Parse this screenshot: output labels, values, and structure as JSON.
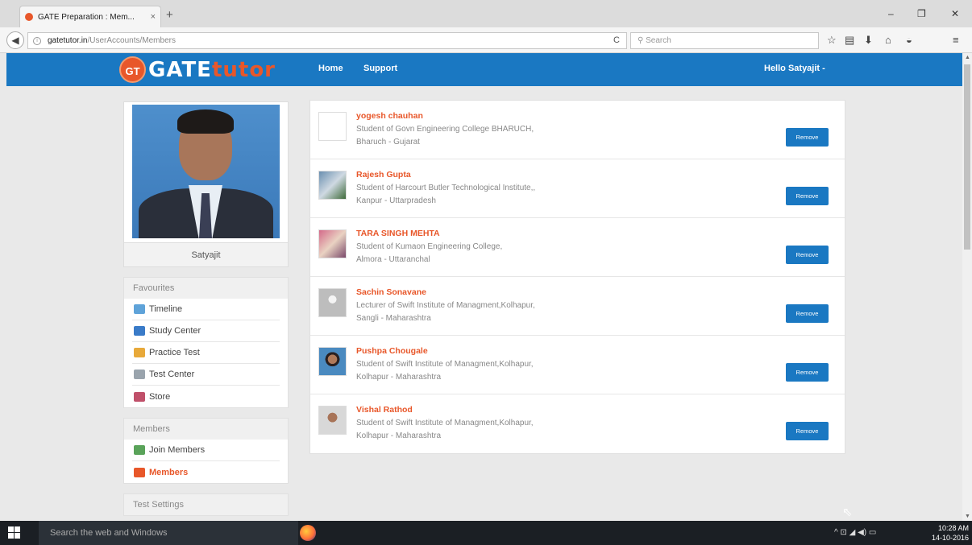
{
  "browser": {
    "tab_title": "GATE Preparation : Mem...",
    "tab_close": "×",
    "new_tab": "+",
    "url_domain": "gatetutor.in",
    "url_path": "/UserAccounts/Members",
    "reload": "C",
    "search_placeholder": "Search",
    "window_controls": {
      "minimize": "–",
      "restore": "❐",
      "close": "✕"
    }
  },
  "header": {
    "logo_badge": "GT",
    "logo_text_1": "GATE",
    "logo_text_2": "tutor",
    "nav": [
      "Home",
      "Support"
    ],
    "user_greeting": "Hello Satyajit -"
  },
  "profile": {
    "name": "Satyajit"
  },
  "sidebar": {
    "favourites_title": "Favourites",
    "favourites": [
      {
        "label": "Timeline",
        "icon": "timeline-icon",
        "color": "#5fa3d9"
      },
      {
        "label": "Study Center",
        "icon": "study-center-icon",
        "color": "#3a7bc8"
      },
      {
        "label": "Practice Test",
        "icon": "practice-test-icon",
        "color": "#e8a93a"
      },
      {
        "label": "Test Center",
        "icon": "test-center-icon",
        "color": "#9aa4ad"
      },
      {
        "label": "Store",
        "icon": "store-icon",
        "color": "#c0506a"
      }
    ],
    "members_title": "Members",
    "members_links": [
      {
        "label": "Join Members",
        "icon": "join-members-icon",
        "color": "#5aa35a",
        "active": false
      },
      {
        "label": "Members",
        "icon": "members-icon",
        "color": "#e8572a",
        "active": true
      }
    ],
    "test_settings_title": "Test Settings"
  },
  "members": [
    {
      "name": "yogesh chauhan",
      "line1": "Student of Govn Engineering College BHARUCH,",
      "line2": "Bharuch - Gujarat",
      "avatar": "blank",
      "button": "Remove"
    },
    {
      "name": "Rajesh Gupta",
      "line1": "Student of Harcourt Butler Technological Institute,,",
      "line2": "Kanpur - Uttarpradesh",
      "avatar": "photo",
      "button": "Remove"
    },
    {
      "name": "TARA SINGH MEHTA",
      "line1": "Student of Kumaon Engineering College,",
      "line2": "Almora - Uttaranchal",
      "avatar": "photo",
      "button": "Remove"
    },
    {
      "name": "Sachin Sonavane",
      "line1": "Lecturer of Swift Institute of Managment,Kolhapur,",
      "line2": "Sangli - Maharashtra",
      "avatar": "placeholder",
      "button": "Remove"
    },
    {
      "name": "Pushpa Chougale",
      "line1": "Student of Swift Institute of Managment,Kolhapur,",
      "line2": "Kolhapur - Maharashtra",
      "avatar": "photo",
      "button": "Remove"
    },
    {
      "name": "Vishal Rathod",
      "line1": "Student of Swift Institute of Managment,Kolhapur,",
      "line2": "Kolhapur - Maharashtra",
      "avatar": "photo",
      "button": "Remove"
    }
  ],
  "taskbar": {
    "search_placeholder": "Search the web and Windows",
    "time": "10:28 AM",
    "date": "14-10-2016"
  }
}
